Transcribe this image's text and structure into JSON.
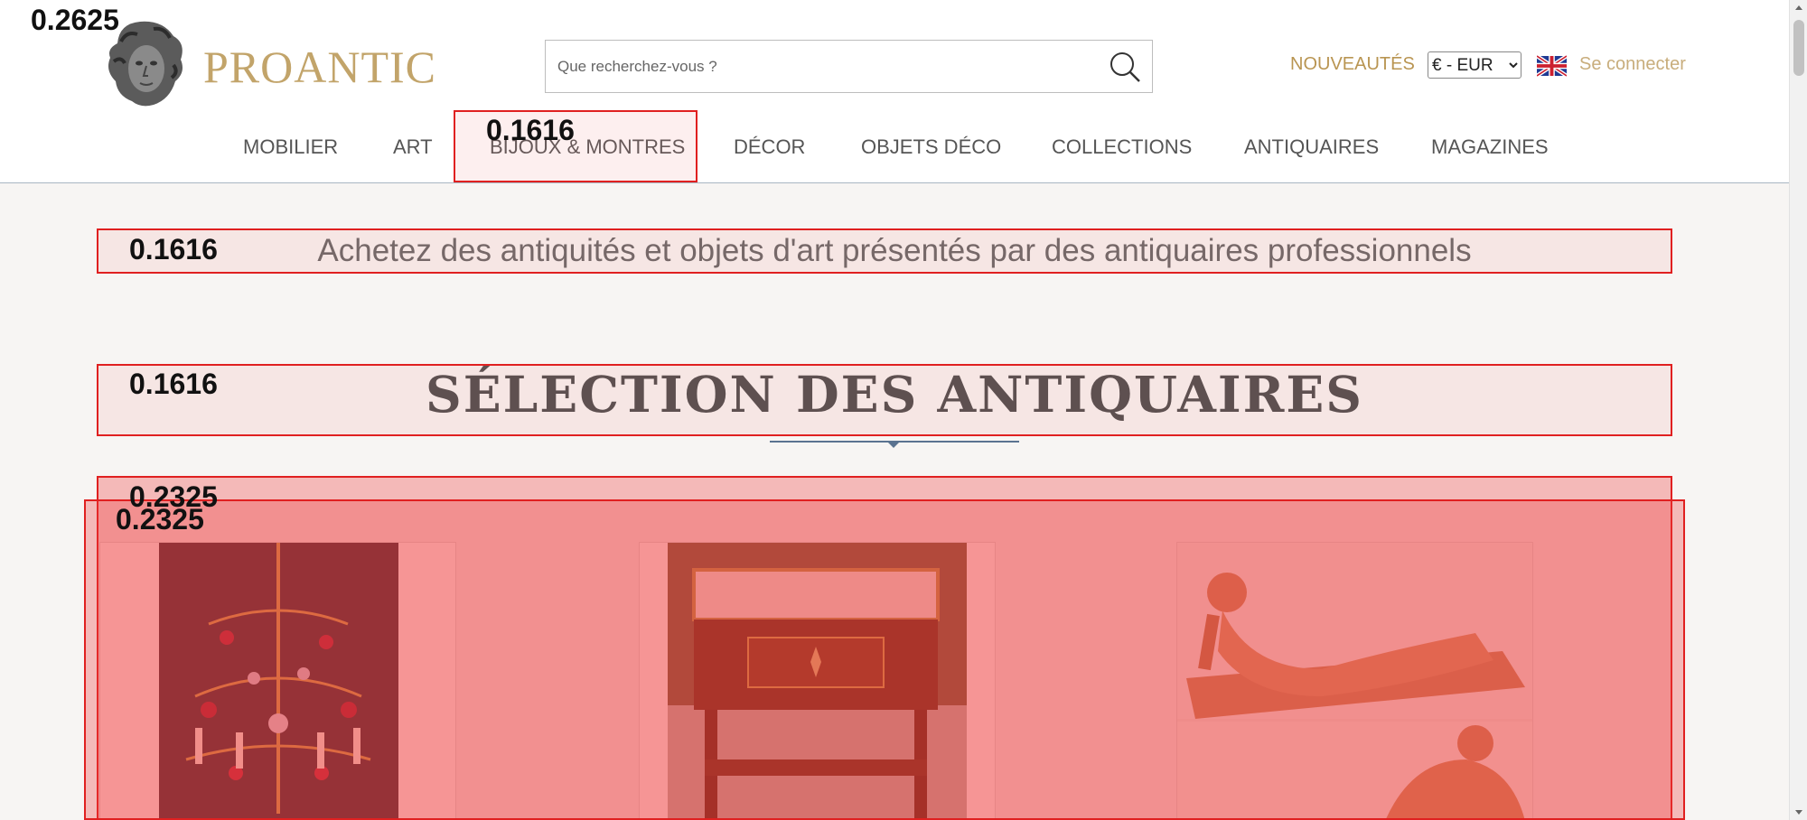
{
  "header": {
    "brand": "PROANTIC",
    "search": {
      "placeholder": "Que recherchez-vous ?"
    },
    "news_link": "NOUVEAUTÉS",
    "currency": {
      "selected": "€ - EUR"
    },
    "language": "English",
    "login": "Se connecter"
  },
  "nav": {
    "items": [
      {
        "label": "MOBILIER"
      },
      {
        "label": "ART"
      },
      {
        "label": "BIJOUX & MONTRES"
      },
      {
        "label": "DÉCOR"
      },
      {
        "label": "OBJETS DÉCO"
      },
      {
        "label": "COLLECTIONS"
      },
      {
        "label": "ANTIQUAIRES"
      },
      {
        "label": "MAGAZINES"
      }
    ]
  },
  "main": {
    "tagline": "Achetez des antiquités et objets d'art présentés par des antiquaires professionnels",
    "section_title": "SÉLECTION DES ANTIQUAIRES",
    "cards": [
      {
        "subject": "crystal chandelier"
      },
      {
        "subject": "marble-top side table"
      },
      {
        "subject": "terracotta reclining figure"
      }
    ]
  },
  "overlays": [
    {
      "label": "0.2625"
    },
    {
      "label": "0.1616"
    },
    {
      "label": "0.1616"
    },
    {
      "label": "0.1616"
    },
    {
      "label": "0.2325"
    },
    {
      "label": "0.2325"
    }
  ],
  "colors": {
    "brand": "#c2a46a",
    "news": "#b99552",
    "login": "#c8ad7c",
    "overlay_border": "#e02020",
    "divider": "#5a7390"
  }
}
